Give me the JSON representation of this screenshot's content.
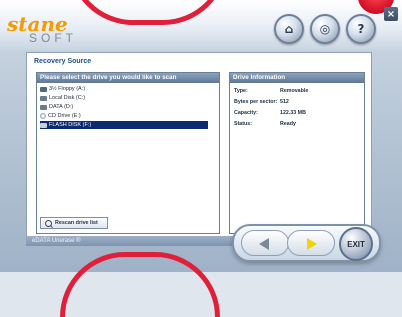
{
  "app": {
    "logo_main": "stane",
    "logo_sub": "SOFT",
    "close_label": "×"
  },
  "title_buttons": [
    {
      "name": "trash-icon-button",
      "glyph": "⌂"
    },
    {
      "name": "globe-icon-button",
      "glyph": "◎"
    },
    {
      "name": "help-button",
      "glyph": "?"
    }
  ],
  "panel": {
    "title": "Recovery Source",
    "left_header": "Please select the drive you would like to scan",
    "drives": [
      {
        "label": "3½ Floppy (A:)",
        "icon": "floppy"
      },
      {
        "label": "Local Disk (C:)",
        "icon": "hard-disk"
      },
      {
        "label": "DATA (D:)",
        "icon": "hard-disk"
      },
      {
        "label": "CD Drive (E:)",
        "icon": "cd"
      },
      {
        "label": "FLASH DISK (F:)",
        "icon": "usb",
        "selected": true
      }
    ],
    "rescan_label": "Rescan drive list",
    "right_header": "Drive Information",
    "info": [
      {
        "label": "Type:",
        "value": "Removable"
      },
      {
        "label": "Bytes per sector:",
        "value": "512"
      },
      {
        "label": "Capacity:",
        "value": "122.33 MB"
      },
      {
        "label": "Status:",
        "value": "Ready"
      }
    ]
  },
  "status_bar": {
    "text": "eDATA Unerase ®"
  },
  "nav": {
    "exit_label": "EXIT"
  },
  "colors": {
    "accent_red": "#e0203a",
    "selected_row": "#0b2a6f",
    "logo_orange": "#f59a00"
  }
}
